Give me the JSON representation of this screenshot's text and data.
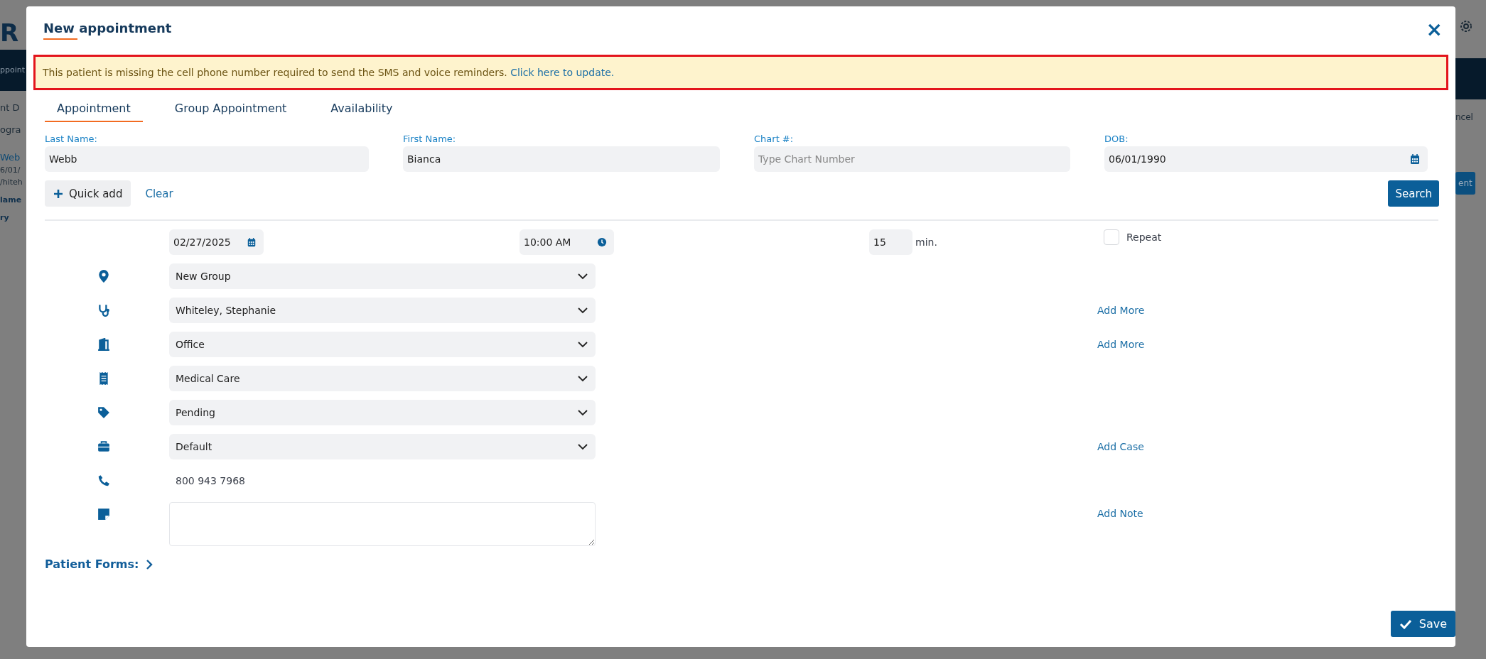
{
  "background_page": {
    "left_fragments": [
      {
        "kind": "logo",
        "text": "R"
      },
      {
        "kind": "bar",
        "text": "ppoint"
      },
      {
        "kind": "heading",
        "text": "nt D"
      },
      {
        "kind": "heading",
        "text": "ogra"
      },
      {
        "kind": "link",
        "text": "Web"
      },
      {
        "kind": "plain",
        "text": "6/01/"
      },
      {
        "kind": "plain",
        "text": "/hiteh"
      },
      {
        "kind": "bold",
        "text": "lame"
      },
      {
        "kind": "bold",
        "text": "ry"
      }
    ],
    "right_fragments": [
      {
        "kind": "plain",
        "text": "ncel"
      },
      {
        "kind": "button",
        "text": "ent"
      }
    ]
  },
  "dialog": {
    "title": "New appointment",
    "close_label": "×"
  },
  "alert": {
    "message": "This patient is missing the cell phone number required to send the SMS and voice reminders.",
    "link": "Click here to update."
  },
  "tabs": [
    {
      "label": "Appointment",
      "selected": true
    },
    {
      "label": "Group Appointment",
      "selected": false
    },
    {
      "label": "Availability",
      "selected": false
    }
  ],
  "patient_fields": [
    {
      "label": "Last Name:",
      "value": "Webb",
      "kind": "text"
    },
    {
      "label": "First Name:",
      "value": "Bianca",
      "kind": "text"
    },
    {
      "label": "Chart #:",
      "placeholder": "Type Chart Number",
      "kind": "text"
    },
    {
      "label": "DOB:",
      "value": "06/01/1990",
      "kind": "date"
    }
  ],
  "quick_add": "Quick add",
  "clear": "Clear",
  "search": "Search",
  "schedule": {
    "date": "02/27/2025",
    "time": "10:00 AM",
    "duration": "15",
    "unit": "min.",
    "repeat": {
      "label": "Repeat",
      "checked": false
    }
  },
  "rows": [
    {
      "kind": "select",
      "value": "New Group"
    },
    {
      "kind": "select",
      "value": "Whiteley, Stephanie",
      "link": "Add More"
    },
    {
      "kind": "select",
      "value": "Office",
      "link": "Add More"
    },
    {
      "kind": "select",
      "value": "Medical Care"
    },
    {
      "kind": "select",
      "value": "Pending"
    },
    {
      "kind": "select",
      "value": "Default",
      "link": "Add Case"
    },
    {
      "kind": "text",
      "value": "800 943 7968"
    },
    {
      "kind": "textarea",
      "link": "Add Note"
    }
  ],
  "patient_forms": "Patient Forms:",
  "save": "Save"
}
